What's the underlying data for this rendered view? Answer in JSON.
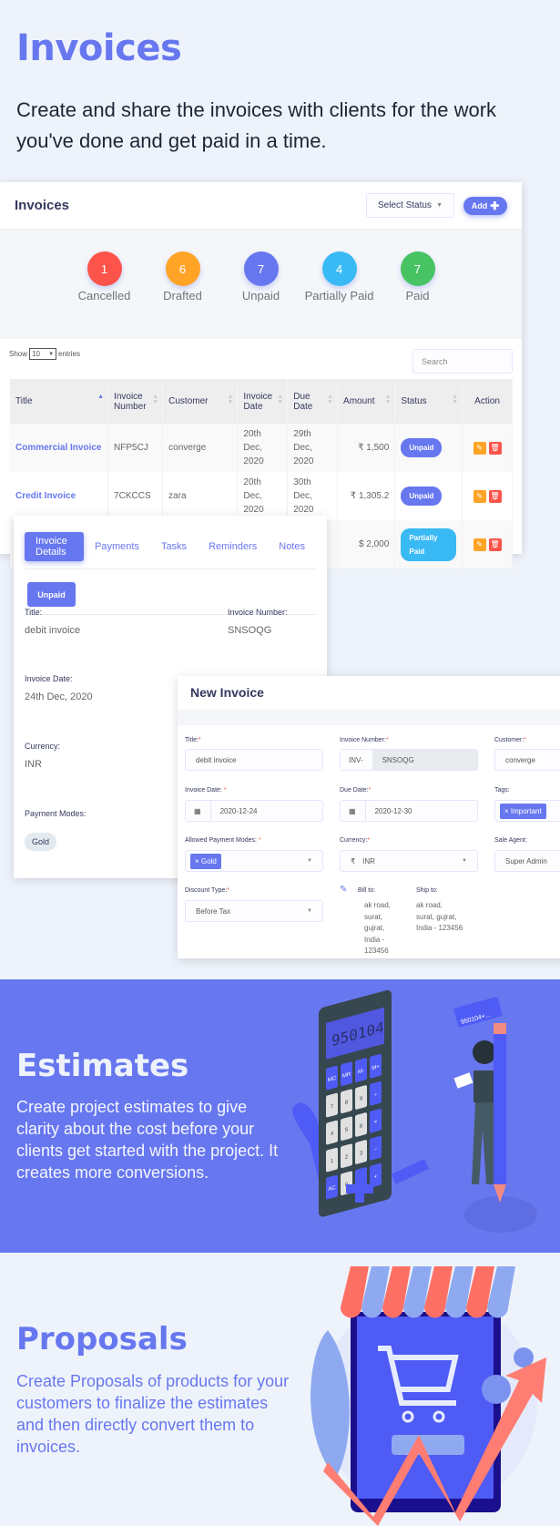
{
  "hero": {
    "title": "Invoices",
    "description": "Create and share the invoices with clients for the work you've done and get paid in a time."
  },
  "invoice_list": {
    "title": "Invoices",
    "select_status_placeholder": "Select Status",
    "add_button": "Add",
    "stats": [
      {
        "count": "1",
        "label": "Cancelled",
        "color": "#fc544b"
      },
      {
        "count": "6",
        "label": "Drafted",
        "color": "#ffa426"
      },
      {
        "count": "7",
        "label": "Unpaid",
        "color": "#6777ef"
      },
      {
        "count": "4",
        "label": "Partially Paid",
        "color": "#3abaf4"
      },
      {
        "count": "7",
        "label": "Paid",
        "color": "#47c363"
      }
    ],
    "show_label": "Show",
    "entries_value": "10",
    "entries_label": "entries",
    "search_placeholder": "Search",
    "columns": [
      "Title",
      "Invoice Number",
      "Customer",
      "Invoice Date",
      "Due Date",
      "Amount",
      "Status",
      "Action"
    ],
    "rows": [
      {
        "title": "Commercial Invoice",
        "number": "NFP5CJ",
        "customer": "converge",
        "invoice_date": "20th Dec, 2020",
        "due_date": "29th Dec, 2020",
        "amount": "₹ 1,500",
        "status": "Unpaid",
        "status_color": "#6777ef"
      },
      {
        "title": "Credit Invoice",
        "number": "7CKCCS",
        "customer": "zara",
        "invoice_date": "20th Dec, 2020",
        "due_date": "30th Dec, 2020",
        "amount": "₹ 1,305.2",
        "status": "Unpaid",
        "status_color": "#6777ef"
      },
      {
        "title": "",
        "number": "",
        "customer": "",
        "invoice_date": "",
        "due_date": "",
        "amount": "$ 2,000",
        "status": "Partially Paid",
        "status_color": "#3abaf4"
      }
    ],
    "edit_color": "#ffa426",
    "delete_color": "#fc544b"
  },
  "invoice_details": {
    "tabs": [
      "Invoice Details",
      "Payments",
      "Tasks",
      "Reminders",
      "Notes"
    ],
    "active_tab": "Invoice Details",
    "status_button": "Unpaid",
    "fields": {
      "title_label": "Title:",
      "title_value": "debit invoice",
      "number_label": "Invoice Number:",
      "number_value": "SNSOQG",
      "date_label": "Invoice Date:",
      "date_value": "24th Dec, 2020",
      "currency_label": "Currency:",
      "currency_value": "INR",
      "payment_modes_label": "Payment Modes:",
      "payment_modes_value": "Gold"
    }
  },
  "new_invoice": {
    "title": "New Invoice",
    "title_label": "Title:",
    "title_value": "debit invoice",
    "number_label": "Invoice Number:",
    "number_prefix": "INV-",
    "number_value": "SNSOQG",
    "customer_label": "Customer:",
    "customer_value": "converge",
    "invoice_date_label": "Invoice Date:",
    "invoice_date_value": "2020-12-24",
    "due_date_label": "Due Date:",
    "due_date_value": "2020-12-30",
    "tags_label": "Tags:",
    "tags_value": "× Important",
    "payment_modes_label": "Allowed Payment Modes:",
    "payment_modes_value": "× Gold",
    "currency_label": "Currency:",
    "currency_symbol": "₹",
    "currency_value": "INR",
    "sale_agent_label": "Sale Agent:",
    "sale_agent_value": "Super Admin",
    "discount_label": "Discount Type:",
    "discount_value": "Before Tax",
    "bill_to_label": "Bill to:",
    "bill_to_lines": [
      "ak road,",
      "surat,",
      "gujrat,",
      "India -",
      "123456"
    ],
    "ship_to_label": "Ship to:",
    "ship_to_lines": [
      "ak road,",
      "surat, gujrat,",
      "India - 123456"
    ],
    "required_mark": "*"
  },
  "estimates": {
    "title": "Estimates",
    "description": "Create project estimates to give clarity about the cost before your clients get started with the project. It creates more conversions.",
    "calculator_display": "950104",
    "speech_bubble": "950104+...",
    "keys": [
      "MC",
      "MR",
      "M-",
      "M+",
      "7",
      "8",
      "9",
      "÷",
      "4",
      "5",
      "6",
      "×",
      "1",
      "2",
      "3",
      "−",
      "AC",
      "0",
      "=",
      "+"
    ]
  },
  "proposals": {
    "title": "Proposals",
    "description": "Create Proposals of products for your customers to finalize the estimates and then directly convert them to invoices."
  }
}
